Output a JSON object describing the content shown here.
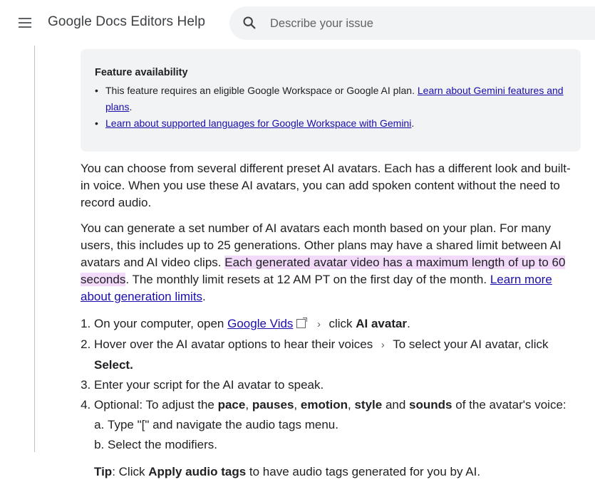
{
  "header": {
    "menu_icon": "hamburger-menu-icon",
    "title": "Google Docs Editors Help",
    "search": {
      "icon": "search-icon",
      "placeholder": "Describe your issue",
      "value": ""
    }
  },
  "callout": {
    "title": "Feature availability",
    "item1_text": "This feature requires an eligible Google Workspace or Google AI plan.",
    "item1_link": "Learn about Gemini features and plans",
    "item1_end": ".",
    "item2_link": "Learn about supported languages for Google Workspace with Gemini",
    "item2_end": "."
  },
  "para1": "You can choose from several different preset AI avatars. Each has a different look and built-in voice. When you use these AI avatars, you can add spoken content without the need to record audio.",
  "para2": {
    "text": "You can generate a set number of AI avatars each month based on your plan. For many users, this includes up to 25 generations. Other plans may have a shared limit between AI avatars and AI video clips.",
    "highlight": "Each generated avatar video has a maximum length of up to 60 seconds",
    "text2": ". The monthly limit resets at 12 AM PT on the first day of the month.",
    "link": "Learn more about generation limits",
    "end": "."
  },
  "steps": {
    "s1_pre": "On your computer, open",
    "s1_link": "Google Vids",
    "s1_external_icon": "external-link-icon",
    "chevron": "›",
    "s1_click": "click",
    "s1_bold": "AI avatar",
    "s1_end": ".",
    "s2_pre": "Hover over the AI avatar options to hear their voices",
    "s2_mid": "To select your AI avatar, click",
    "s2_bold": "Select.",
    "s3": "Enter your script for the AI avatar to speak.",
    "s4_pre": "Optional: To adjust the",
    "s4_b1": "pace",
    "s4_comma1": ",",
    "s4_b2": "pauses",
    "s4_comma2": ",",
    "s4_b3": "emotion",
    "s4_comma3": ",",
    "s4_b4": "style",
    "s4_and": "and",
    "s4_b5": "sounds",
    "s4_post": "of the avatar's voice:",
    "s4a": "Type \"[\" and navigate the audio tags menu.",
    "s4b": "Select the modifiers."
  },
  "tip": {
    "label": "Tip",
    "pre": ": Click",
    "bold": "Apply audio tags",
    "post": "to have audio tags generated for you by AI."
  }
}
